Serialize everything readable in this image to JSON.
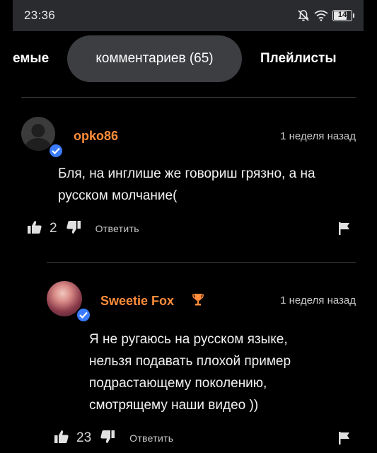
{
  "status_bar": {
    "time": "23:36",
    "icons": [
      "bell-muted-icon",
      "wifi-icon"
    ],
    "battery": "14"
  },
  "tabs": {
    "left_partial": "емые",
    "active": "комментариев (65)",
    "right": "Плейлисты"
  },
  "comments": [
    {
      "username": "opko86",
      "time": "1 неделя назад",
      "text_line1": "Бля, на инглише же говориш грязно, а на",
      "text_line2": "русском молчание(",
      "likes": "2",
      "reply_label": "Ответить"
    },
    {
      "username": "Sweetie Fox",
      "badge_icon": "trophy-icon",
      "time": "1 неделя назад",
      "text_line1": "Я не ругаюсь на русском языке,",
      "text_line2": "нельзя подавать плохой пример",
      "text_line3": "подрастающему поколению,",
      "text_line4": "смотрящему наши видео ))",
      "likes": "23",
      "reply_label": "Ответить"
    }
  ],
  "colors": {
    "background": "#000000",
    "username": "#ff8d3b",
    "active_tab": "#3d3e42",
    "verified": "#3a7bff"
  }
}
